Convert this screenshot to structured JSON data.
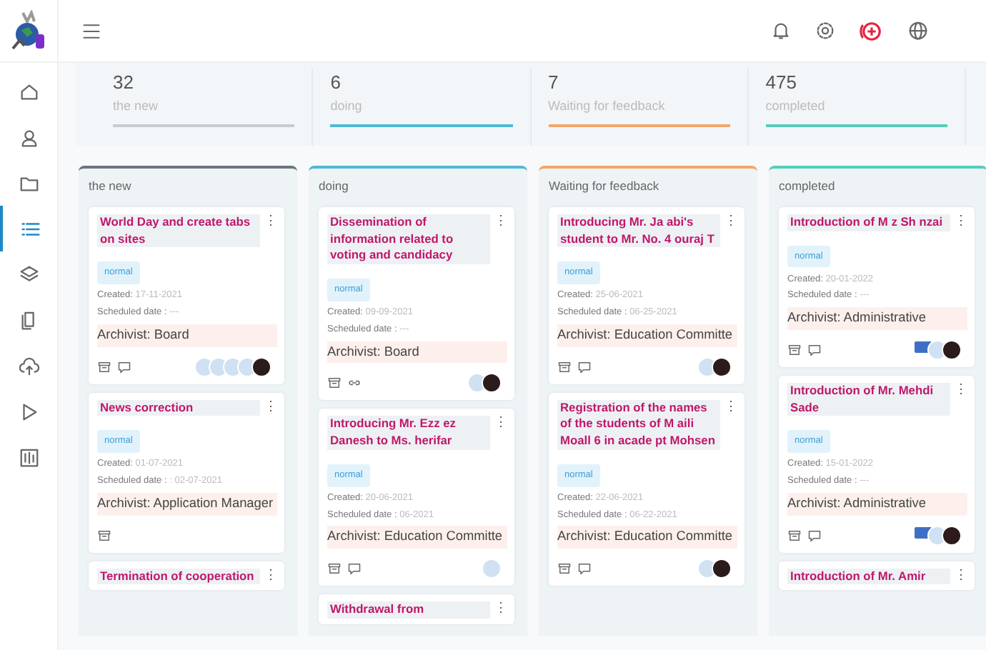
{
  "sidebar": {
    "items": [
      {
        "selected": false
      },
      {
        "selected": false
      },
      {
        "selected": false
      },
      {
        "selected": true
      },
      {
        "selected": false
      },
      {
        "selected": false
      },
      {
        "selected": false
      },
      {
        "selected": false
      },
      {
        "selected": false
      }
    ]
  },
  "stats": [
    {
      "count": "32",
      "label": "the new",
      "color": "#c8cccf"
    },
    {
      "count": "6",
      "label": "doing",
      "color": "#4fb8d6"
    },
    {
      "count": "7",
      "label": "Waiting for feedback",
      "color": "#f2a66a"
    },
    {
      "count": "475",
      "label": "completed",
      "color": "#55cdb9"
    }
  ],
  "columns": [
    {
      "title": "the new",
      "color": "#6c757d",
      "cards": [
        {
          "title": "World Day and create tabs on sites",
          "menu": "⋮",
          "priority": "normal",
          "created_label": "Created:",
          "created": "17-11-2021",
          "scheduled_label": "Scheduled date :",
          "scheduled": "---",
          "archivist": "Archivist: Board",
          "footer_icons": [
            {
              "kind": "archive"
            },
            {
              "kind": "comment"
            }
          ],
          "avatars": [
            {
              "kind": "default"
            },
            {
              "kind": "default"
            },
            {
              "kind": "default"
            },
            {
              "kind": "default"
            },
            {
              "kind": "photo"
            }
          ]
        },
        {
          "title": "News correction",
          "menu": "⋮",
          "priority": "normal",
          "created_label": "Created:",
          "created": "01-07-2021",
          "scheduled_label": "Scheduled date :",
          "scheduled": ": 02-07-2021",
          "archivist": "Archivist: Application Manager",
          "footer_icons": [
            {
              "kind": "archive"
            }
          ]
        },
        {
          "title": "Termination of cooperation",
          "menu": "⋮"
        }
      ]
    },
    {
      "title": "doing",
      "color": "#4fb8d6",
      "cards": [
        {
          "title": "Dissemination of information related to voting and candidacy",
          "menu": "⋮",
          "priority": "normal",
          "created_label": "Created:",
          "created": "09-09-2021",
          "scheduled_label": "Scheduled date :",
          "scheduled": "---",
          "archivist": "Archivist: Board",
          "footer_icons": [
            {
              "kind": "archive"
            },
            {
              "kind": "link"
            }
          ],
          "avatars": [
            {
              "kind": "default"
            },
            {
              "kind": "photo"
            }
          ]
        },
        {
          "title": "Introducing Mr. Ezz ez Danesh to Ms. herifar",
          "menu": "⋮",
          "priority": "normal",
          "created_label": "Created:",
          "created": "20-06-2021",
          "scheduled_label": "Scheduled date :",
          "scheduled": "06-2021",
          "archivist": "Archivist: Education Committe",
          "footer_icons": [
            {
              "kind": "archive"
            },
            {
              "kind": "comment"
            }
          ],
          "avatars": [
            {
              "kind": "default"
            }
          ]
        },
        {
          "title": "Withdrawal from",
          "menu": "⋮"
        }
      ]
    },
    {
      "title": "Waiting for feedback",
      "color": "#f2a66a",
      "cards": [
        {
          "title": "Introducing Mr. Ja abi's student to Mr. No. 4 ouraj T",
          "menu": "⋮",
          "priority": "normal",
          "created_label": "Created:",
          "created": "25-06-2021",
          "scheduled_label": "Scheduled date :",
          "scheduled": "06-25-2021",
          "archivist": "Archivist: Education Committe",
          "footer_icons": [
            {
              "kind": "archive"
            },
            {
              "kind": "comment"
            }
          ],
          "avatars": [
            {
              "kind": "default"
            },
            {
              "kind": "photo"
            }
          ]
        },
        {
          "title": "Registration of the names of the students of M aili Moall 6 in acade pt Mohsen",
          "menu": "⋮",
          "priority": "normal",
          "created_label": "Created:",
          "created": "22-06-2021",
          "scheduled_label": "Scheduled date :",
          "scheduled": "06-22-2021",
          "archivist": "Archivist: Education Committe",
          "footer_icons": [
            {
              "kind": "archive"
            },
            {
              "kind": "comment"
            }
          ],
          "avatars": [
            {
              "kind": "default"
            },
            {
              "kind": "photo"
            }
          ]
        }
      ]
    },
    {
      "title": "completed",
      "color": "#55cdb9",
      "cards": [
        {
          "title": "Introduction of M z Sh nzai",
          "menu": "⋮",
          "priority": "normal",
          "created_label": "Created:",
          "created": "20-01-2022",
          "scheduled_label": "Scheduled date :",
          "scheduled": "---",
          "archivist": "Archivist: Administrative",
          "footer_icons": [
            {
              "kind": "archive"
            },
            {
              "kind": "comment"
            }
          ],
          "avatars": [
            {
              "kind": "logo"
            },
            {
              "kind": "default"
            },
            {
              "kind": "photo"
            }
          ]
        },
        {
          "title": "Introduction of Mr. Mehdi Sade",
          "menu": "⋮",
          "priority": "normal",
          "created_label": "Created:",
          "created": "15-01-2022",
          "scheduled_label": "Scheduled date :",
          "scheduled": "---",
          "archivist": "Archivist: Administrative",
          "footer_icons": [
            {
              "kind": "archive"
            },
            {
              "kind": "comment"
            }
          ],
          "avatars": [
            {
              "kind": "logo"
            },
            {
              "kind": "default"
            },
            {
              "kind": "photo"
            }
          ]
        },
        {
          "title": "Introduction of Mr. Amir",
          "menu": "⋮"
        }
      ]
    }
  ]
}
